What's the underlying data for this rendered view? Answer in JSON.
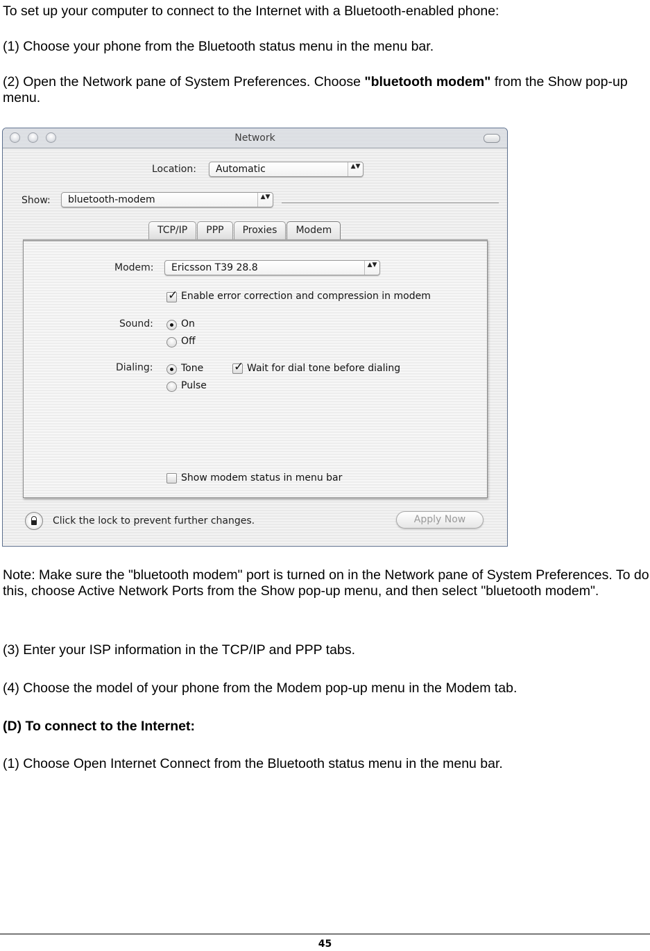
{
  "document": {
    "intro": "To set up your computer to connect to the Internet with a Bluetooth-enabled phone:",
    "step1": "(1) Choose your phone from the Bluetooth status menu in the menu bar.",
    "step2_pre": "(2) Open the Network pane of System Preferences. Choose ",
    "step2_bold": "\"bluetooth modem\"",
    "step2_post": " from the Show pop-up menu.",
    "note": "Note: Make sure the \"bluetooth modem\" port is turned on in the Network pane of System Preferences. To do this, choose Active Network Ports from the Show pop-up menu, and then select \"bluetooth modem\".",
    "step3": "(3) Enter your ISP information in the TCP/IP and PPP tabs.",
    "step4": "(4) Choose the model of your phone from the Modem pop-up menu in the Modem tab.",
    "section_d_heading": "(D) To connect to the Internet:",
    "section_d_step1": "(1) Choose Open Internet Connect from the Bluetooth status menu in the menu bar.",
    "page_number": "45"
  },
  "window": {
    "title": "Network",
    "location_label": "Location:",
    "location_value": "Automatic",
    "show_label": "Show:",
    "show_value": "bluetooth-modem",
    "tabs": [
      {
        "label": "TCP/IP",
        "active": false
      },
      {
        "label": "PPP",
        "active": false
      },
      {
        "label": "Proxies",
        "active": false
      },
      {
        "label": "Modem",
        "active": true
      }
    ],
    "modem_label": "Modem:",
    "modem_value": "Ericsson T39 28.8",
    "error_correction_label": "Enable error correction and compression in modem",
    "error_correction_checked": true,
    "sound_label": "Sound:",
    "sound_options": [
      "On",
      "Off"
    ],
    "sound_selected": "On",
    "dialing_label": "Dialing:",
    "dialing_options": [
      "Tone",
      "Pulse"
    ],
    "dialing_selected": "Tone",
    "wait_dial_tone_label": "Wait for dial tone before dialing",
    "wait_dial_tone_checked": true,
    "show_modem_status_label": "Show modem status in menu bar",
    "show_modem_status_checked": false,
    "lock_text": "Click the lock to prevent further changes.",
    "apply_button": "Apply Now",
    "checkmark_glyph": "✓",
    "popup_arrows_glyph": "▲▼"
  }
}
